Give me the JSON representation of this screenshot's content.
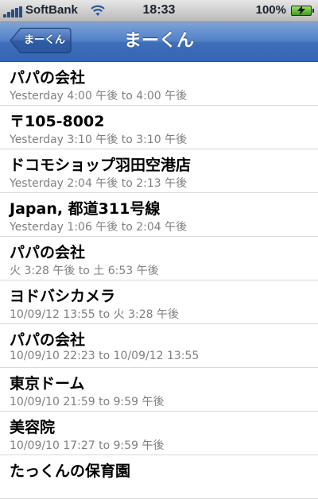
{
  "status_bar": {
    "carrier": "SoftBank",
    "time": "18:33",
    "battery": "100%",
    "icons": [
      "signal-icon",
      "wifi-icon",
      "battery-charging-icon"
    ]
  },
  "nav": {
    "back_label": "まーくん",
    "title": "まーくん"
  },
  "colors": {
    "nav_bar": "#3f6fba",
    "subtitle": "#7f7f7f"
  },
  "items": [
    {
      "title": "パパの会社",
      "subtitle": "Yesterday 4:00 午後 to 4:00 午後"
    },
    {
      "title": "〒105-8002",
      "subtitle": "Yesterday 3:10 午後 to 3:10 午後"
    },
    {
      "title": "ドコモショップ羽田空港店",
      "subtitle": "Yesterday 2:04 午後 to 2:13 午後"
    },
    {
      "title": "Japan, 都道311号線",
      "subtitle": "Yesterday 1:06 午後 to 2:04 午後"
    },
    {
      "title": "パパの会社",
      "subtitle": "火 3:28 午後 to 土 6:53 午後"
    },
    {
      "title": "ヨドバシカメラ",
      "subtitle": "10/09/12 13:55 to 火 3:28 午後"
    },
    {
      "title": "パパの会社",
      "subtitle": "10/09/10 22:23 to 10/09/12 13:55"
    },
    {
      "title": "東京ドーム",
      "subtitle": "10/09/10 21:59 to 9:59 午後"
    },
    {
      "title": "美容院",
      "subtitle": "10/09/10 17:27 to 9:59 午後"
    },
    {
      "title": "たっくんの保育園",
      "subtitle": ""
    }
  ]
}
